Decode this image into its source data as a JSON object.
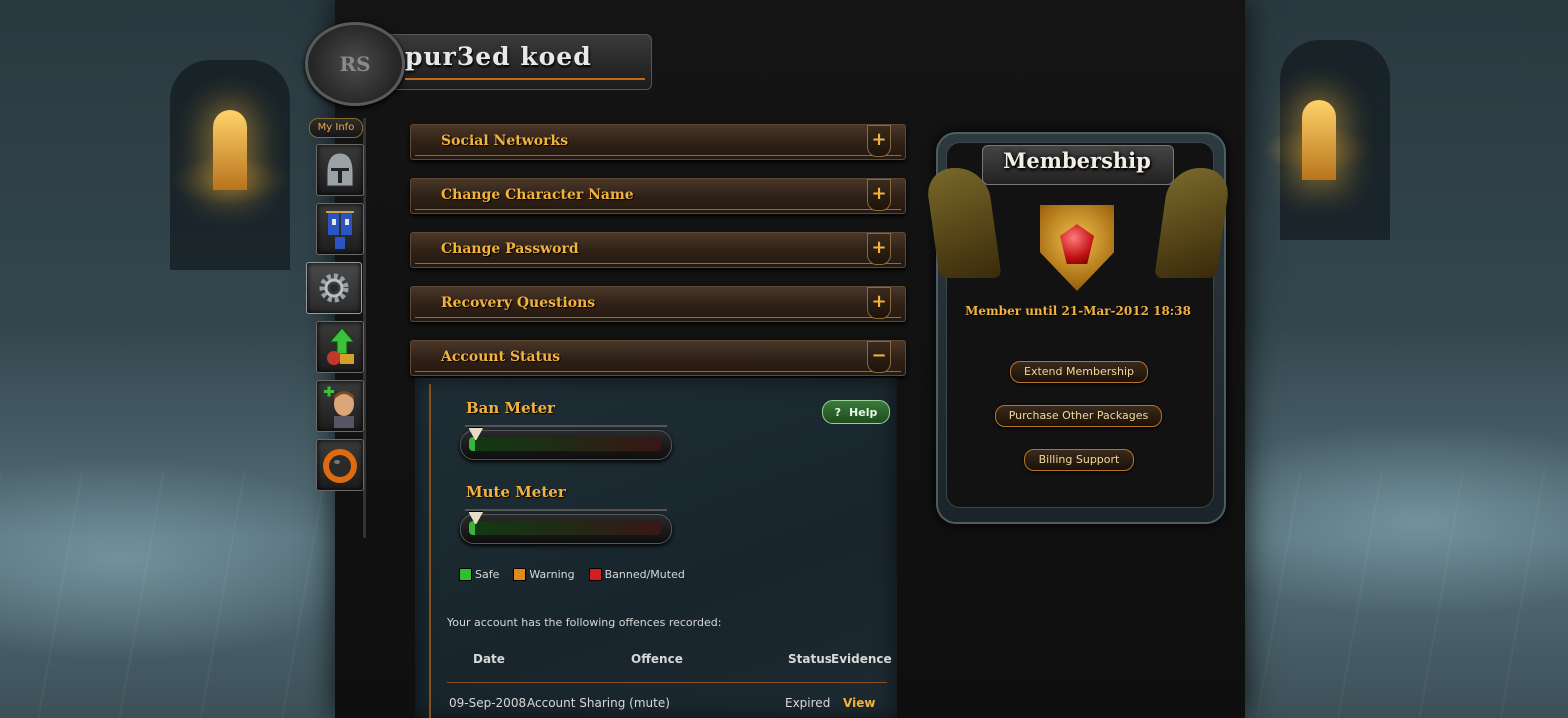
{
  "header": {
    "player_name": "pur3ed koed",
    "emblem_text": "RS"
  },
  "nav": {
    "tab_label": "My Info",
    "icons": [
      {
        "name": "helmet-icon"
      },
      {
        "name": "banner-icon"
      },
      {
        "name": "gear-icon"
      },
      {
        "name": "upgrade-arrow-icon"
      },
      {
        "name": "add-friend-icon"
      },
      {
        "name": "bomb-icon"
      }
    ]
  },
  "accordion": [
    {
      "label": "Social Networks",
      "toggle": "+"
    },
    {
      "label": "Change Character Name",
      "toggle": "+"
    },
    {
      "label": "Change Password",
      "toggle": "+"
    },
    {
      "label": "Recovery Questions",
      "toggle": "+"
    },
    {
      "label": "Account Status",
      "toggle": "−"
    }
  ],
  "account_status": {
    "help_label": "Help",
    "help_glyph": "?",
    "ban_meter": {
      "title": "Ban Meter",
      "level": 0.03
    },
    "mute_meter": {
      "title": "Mute Meter",
      "level": 0.03
    },
    "legend": [
      {
        "label": "Safe",
        "color": "#2fbf2f"
      },
      {
        "label": "Warning",
        "color": "#e08a1e"
      },
      {
        "label": "Banned/Muted",
        "color": "#d21f1f"
      }
    ],
    "offences_intro": "Your account has the following offences recorded:",
    "columns": {
      "date": "Date",
      "offence": "Offence",
      "status": "Status",
      "evidence": "Evidence"
    },
    "rows": [
      {
        "date": "09-Sep-2008",
        "offence": "Account Sharing (mute)",
        "status": "Expired",
        "evidence": "View"
      }
    ]
  },
  "membership": {
    "title": "Membership",
    "member_until": "Member until 21-Mar-2012 18:38",
    "buttons": {
      "extend": "Extend Membership",
      "purchase": "Purchase Other Packages",
      "billing": "Billing Support"
    }
  },
  "colors": {
    "accent_gold": "#f2b23f",
    "panel_teal": "#1f2e36",
    "bar_brown": "#4a3728"
  }
}
